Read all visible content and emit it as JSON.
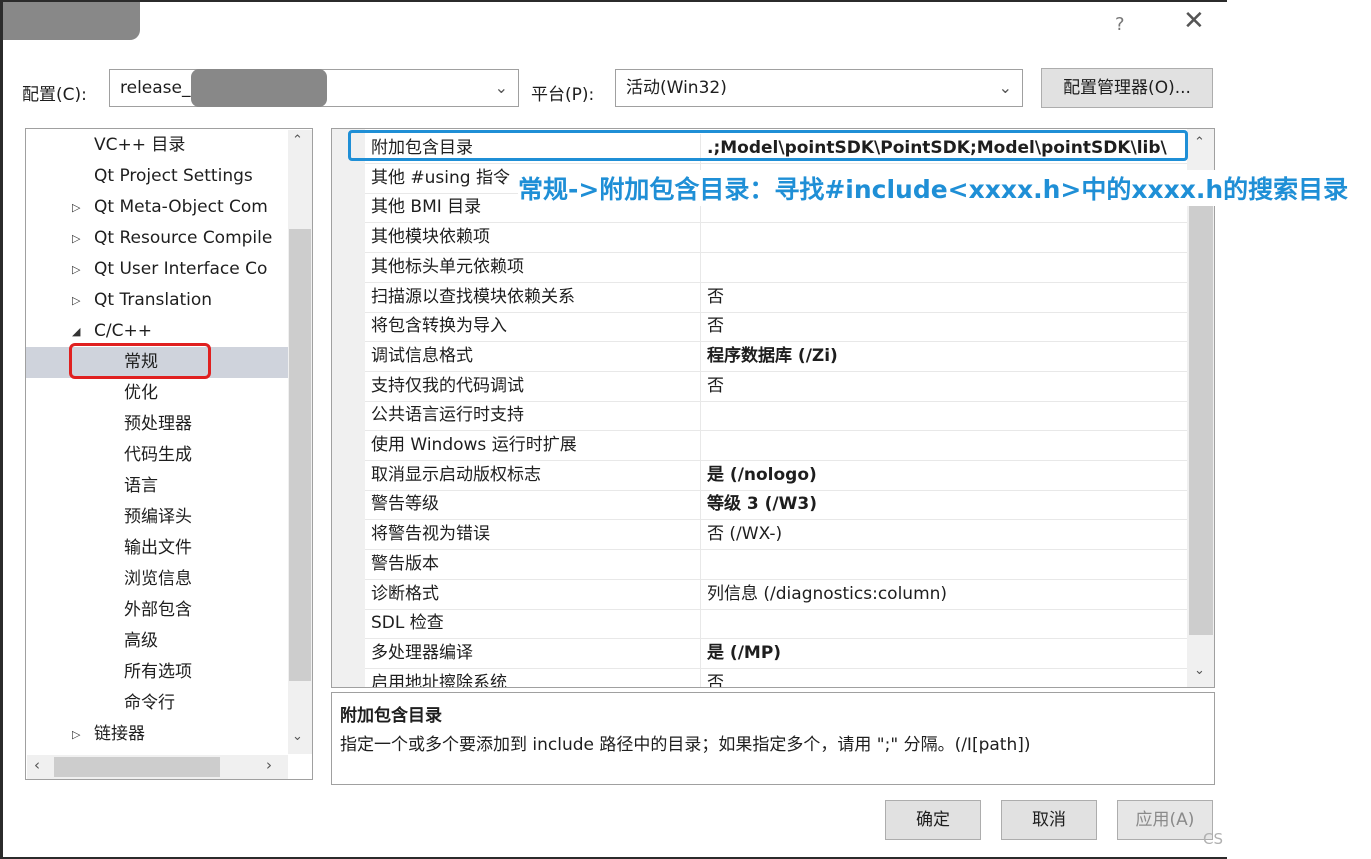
{
  "window": {
    "help_label": "?",
    "close_label": "✕"
  },
  "config_row": {
    "config_label": "配置(C):",
    "config_value": "release_",
    "platform_label": "平台(P):",
    "platform_value": "活动(Win32)",
    "manager_button": "配置管理器(O)..."
  },
  "tree": {
    "items": [
      {
        "label": "VC++ 目录",
        "expander": ""
      },
      {
        "label": "Qt Project Settings",
        "expander": ""
      },
      {
        "label": "Qt Meta-Object Com",
        "expander": "▷"
      },
      {
        "label": "Qt Resource Compile",
        "expander": "▷"
      },
      {
        "label": "Qt User Interface Co",
        "expander": "▷"
      },
      {
        "label": "Qt Translation",
        "expander": "▷"
      },
      {
        "label": "C/C++",
        "expander": "◢"
      },
      {
        "label": "常规",
        "expander": ""
      },
      {
        "label": "优化",
        "expander": ""
      },
      {
        "label": "预处理器",
        "expander": ""
      },
      {
        "label": "代码生成",
        "expander": ""
      },
      {
        "label": "语言",
        "expander": ""
      },
      {
        "label": "预编译头",
        "expander": ""
      },
      {
        "label": "输出文件",
        "expander": ""
      },
      {
        "label": "浏览信息",
        "expander": ""
      },
      {
        "label": "外部包含",
        "expander": ""
      },
      {
        "label": "高级",
        "expander": ""
      },
      {
        "label": "所有选项",
        "expander": ""
      },
      {
        "label": "命令行",
        "expander": ""
      },
      {
        "label": "链接器",
        "expander": "▷"
      }
    ],
    "selected_index": 7
  },
  "properties": [
    {
      "name": "附加包含目录",
      "value": ".;Model\\pointSDK\\PointSDK;Model\\pointSDK\\lib\\",
      "bold": true
    },
    {
      "name": "其他 #using 指令",
      "value": "",
      "bold": false
    },
    {
      "name": "其他 BMI 目录",
      "value": "",
      "bold": false
    },
    {
      "name": "其他模块依赖项",
      "value": "",
      "bold": false
    },
    {
      "name": "其他标头单元依赖项",
      "value": "",
      "bold": false
    },
    {
      "name": "扫描源以查找模块依赖关系",
      "value": "否",
      "bold": false
    },
    {
      "name": "将包含转换为导入",
      "value": "否",
      "bold": false
    },
    {
      "name": "调试信息格式",
      "value": "程序数据库 (/Zi)",
      "bold": true
    },
    {
      "name": "支持仅我的代码调试",
      "value": "否",
      "bold": false
    },
    {
      "name": "公共语言运行时支持",
      "value": "",
      "bold": false
    },
    {
      "name": "使用 Windows 运行时扩展",
      "value": "",
      "bold": false
    },
    {
      "name": "取消显示启动版权标志",
      "value": "是 (/nologo)",
      "bold": true
    },
    {
      "name": "警告等级",
      "value": "等级 3 (/W3)",
      "bold": true
    },
    {
      "name": "将警告视为错误",
      "value": "否 (/WX-)",
      "bold": false
    },
    {
      "name": "警告版本",
      "value": "",
      "bold": false
    },
    {
      "name": "诊断格式",
      "value": "列信息 (/diagnostics:column)",
      "bold": false
    },
    {
      "name": "SDL 检查",
      "value": "",
      "bold": false
    },
    {
      "name": "多处理器编译",
      "value": "是 (/MP)",
      "bold": true
    },
    {
      "name": "启用地址擦除系统",
      "value": "否",
      "bold": false
    }
  ],
  "description": {
    "title": "附加包含目录",
    "text": "指定一个或多个要添加到 include 路径中的目录；如果指定多个，请用 \";\" 分隔。(/I[path])"
  },
  "buttons": {
    "ok": "确定",
    "cancel": "取消",
    "apply": "应用(A)"
  },
  "annotation": {
    "text": "常规->附加包含目录：寻找#include<xxxx.h>中的xxxx.h的搜索目录",
    "color": "#1f8fd6",
    "red_color": "#e02020"
  },
  "watermark": "CS"
}
